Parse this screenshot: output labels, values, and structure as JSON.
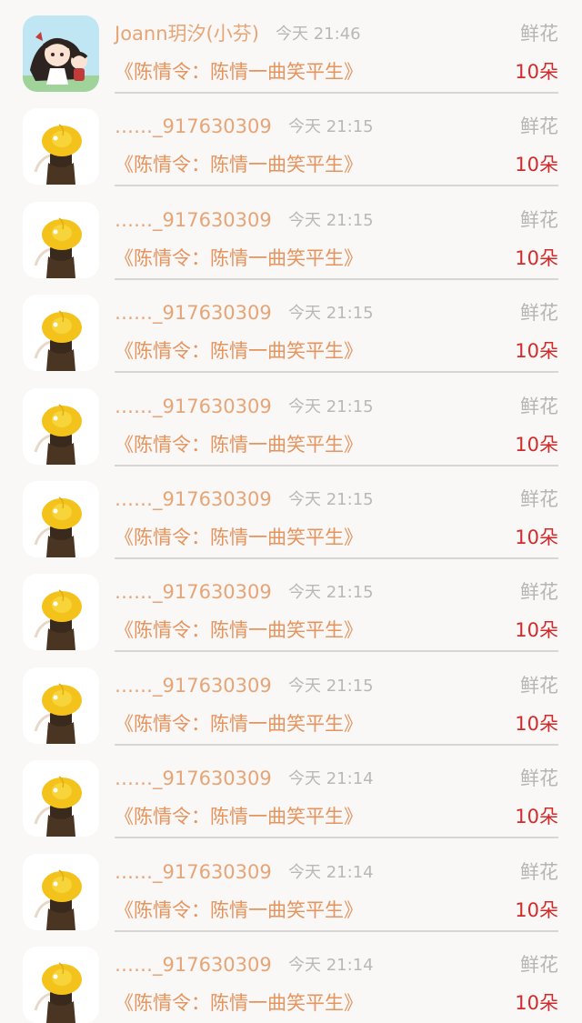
{
  "rows": [
    {
      "username": "Joann玥汐(小芬)",
      "time": "今天 21:46",
      "gift_type": "鲜花",
      "book_title": "《陈情令：陈情一曲笑平生》",
      "amount": "10朵",
      "avatar": "anime-chibi"
    },
    {
      "username": "……_917630309",
      "time": "今天 21:15",
      "gift_type": "鲜花",
      "book_title": "《陈情令：陈情一曲笑平生》",
      "amount": "10朵",
      "avatar": "yellow-hat-girl"
    },
    {
      "username": "……_917630309",
      "time": "今天 21:15",
      "gift_type": "鲜花",
      "book_title": "《陈情令：陈情一曲笑平生》",
      "amount": "10朵",
      "avatar": "yellow-hat-girl"
    },
    {
      "username": "……_917630309",
      "time": "今天 21:15",
      "gift_type": "鲜花",
      "book_title": "《陈情令：陈情一曲笑平生》",
      "amount": "10朵",
      "avatar": "yellow-hat-girl"
    },
    {
      "username": "……_917630309",
      "time": "今天 21:15",
      "gift_type": "鲜花",
      "book_title": "《陈情令：陈情一曲笑平生》",
      "amount": "10朵",
      "avatar": "yellow-hat-girl"
    },
    {
      "username": "……_917630309",
      "time": "今天 21:15",
      "gift_type": "鲜花",
      "book_title": "《陈情令：陈情一曲笑平生》",
      "amount": "10朵",
      "avatar": "yellow-hat-girl"
    },
    {
      "username": "……_917630309",
      "time": "今天 21:15",
      "gift_type": "鲜花",
      "book_title": "《陈情令：陈情一曲笑平生》",
      "amount": "10朵",
      "avatar": "yellow-hat-girl"
    },
    {
      "username": "……_917630309",
      "time": "今天 21:15",
      "gift_type": "鲜花",
      "book_title": "《陈情令：陈情一曲笑平生》",
      "amount": "10朵",
      "avatar": "yellow-hat-girl"
    },
    {
      "username": "……_917630309",
      "time": "今天 21:14",
      "gift_type": "鲜花",
      "book_title": "《陈情令：陈情一曲笑平生》",
      "amount": "10朵",
      "avatar": "yellow-hat-girl"
    },
    {
      "username": "……_917630309",
      "time": "今天 21:14",
      "gift_type": "鲜花",
      "book_title": "《陈情令：陈情一曲笑平生》",
      "amount": "10朵",
      "avatar": "yellow-hat-girl"
    },
    {
      "username": "……_917630309",
      "time": "今天 21:14",
      "gift_type": "鲜花",
      "book_title": "《陈情令：陈情一曲笑平生》",
      "amount": "10朵",
      "avatar": "yellow-hat-girl"
    }
  ],
  "colors": {
    "username": "#e6a576",
    "time": "#b8b8b8",
    "gift_type": "#b5b5b5",
    "book_title": "#e6945d",
    "amount": "#d22a2a",
    "divider": "#d9d5d5"
  }
}
